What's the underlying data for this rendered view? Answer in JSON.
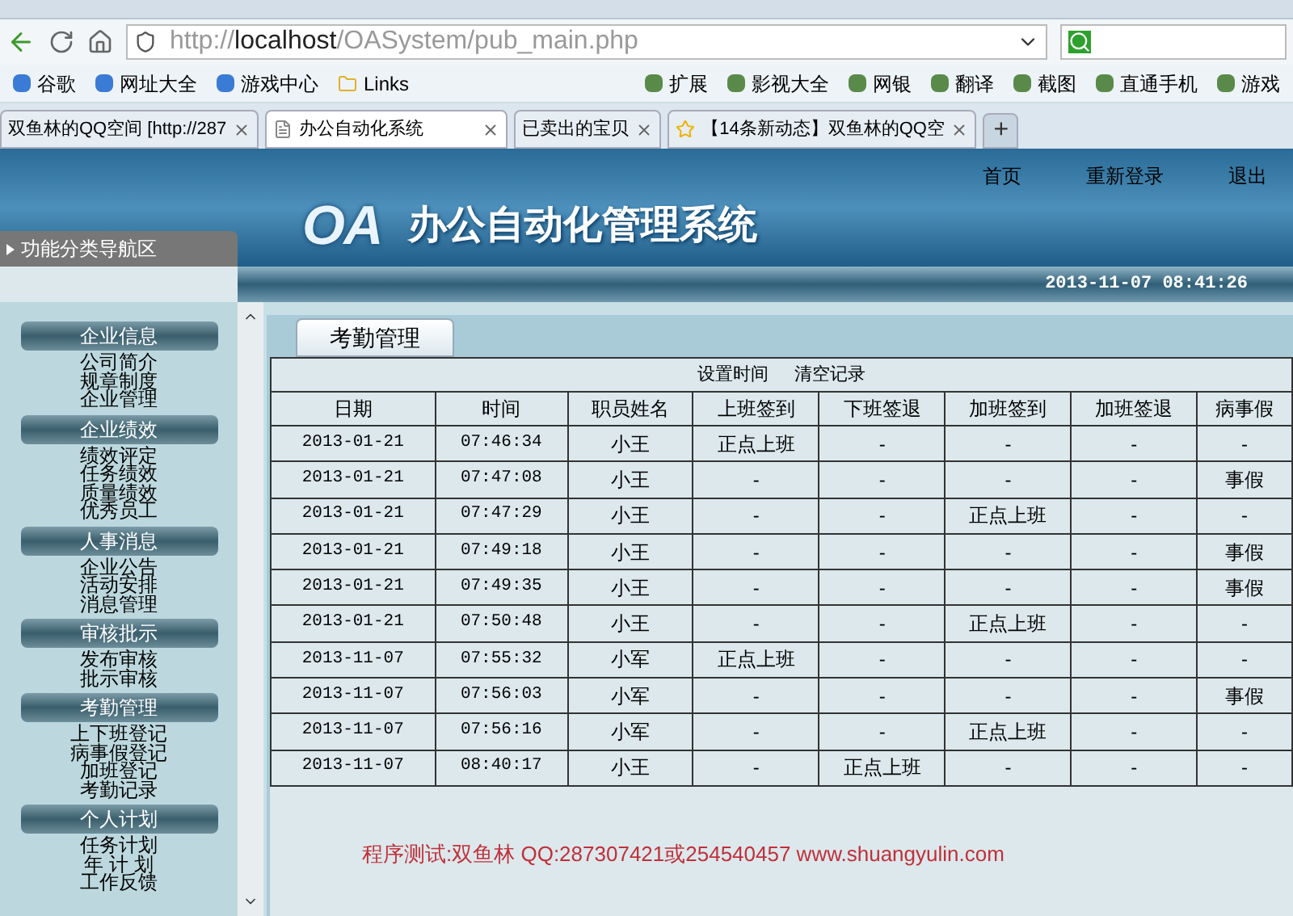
{
  "browser": {
    "url": {
      "scheme": "http://",
      "host": "localhost",
      "path": "/OASystem/pub_main.php"
    },
    "bookmarks": [
      "谷歌",
      "网址大全",
      "游戏中心",
      "Links"
    ],
    "bookmarks_right": [
      "扩展",
      "影视大全",
      "网银",
      "翻译",
      "截图",
      "直通手机",
      "游戏"
    ],
    "tabs": [
      {
        "label": "双鱼林的QQ空间 [http://287",
        "selected": false
      },
      {
        "label": "办公自动化系统",
        "selected": true
      },
      {
        "label": "已卖出的宝贝",
        "selected": false
      },
      {
        "label": "【14条新动态】双鱼林的QQ空",
        "selected": false
      }
    ],
    "new_tab": "+"
  },
  "header": {
    "nav_links": [
      "首页",
      "重新登录",
      "退出"
    ],
    "logo": "OA",
    "title": "办公自动化管理系统",
    "datetime": "2013-11-07 08:41:26"
  },
  "sidebar": {
    "heading": "功能分类导航区",
    "sections": [
      {
        "title": "企业信息",
        "items": [
          "公司简介",
          "规章制度",
          "企业管理"
        ]
      },
      {
        "title": "企业绩效",
        "items": [
          "绩效评定",
          "任务绩效",
          "质量绩效",
          "优秀员工"
        ]
      },
      {
        "title": "人事消息",
        "items": [
          "企业公告",
          "活动安排",
          "消息管理"
        ]
      },
      {
        "title": "审核批示",
        "items": [
          "发布审核",
          "批示审核"
        ]
      },
      {
        "title": "考勤管理",
        "items": [
          "上下班登记",
          "病事假登记",
          "加班登记",
          "考勤记录"
        ]
      },
      {
        "title": "个人计划",
        "items": [
          "任务计划",
          "年 计 划",
          "工作反馈"
        ]
      }
    ]
  },
  "content": {
    "tab_label": "考勤管理",
    "actions": [
      "设置时间",
      "清空记录"
    ],
    "table": {
      "columns": [
        "日期",
        "时间",
        "职员姓名",
        "上班签到",
        "下班签退",
        "加班签到",
        "加班签退",
        "病事假"
      ],
      "rows": [
        [
          "2013-01-21",
          "07:46:34",
          "小王",
          "正点上班",
          "-",
          "-",
          "-",
          "-"
        ],
        [
          "2013-01-21",
          "07:47:08",
          "小王",
          "-",
          "-",
          "-",
          "-",
          "事假"
        ],
        [
          "2013-01-21",
          "07:47:29",
          "小王",
          "-",
          "-",
          "正点上班",
          "-",
          "-"
        ],
        [
          "2013-01-21",
          "07:49:18",
          "小王",
          "-",
          "-",
          "-",
          "-",
          "事假"
        ],
        [
          "2013-01-21",
          "07:49:35",
          "小王",
          "-",
          "-",
          "-",
          "-",
          "事假"
        ],
        [
          "2013-01-21",
          "07:50:48",
          "小王",
          "-",
          "-",
          "正点上班",
          "-",
          "-"
        ],
        [
          "2013-11-07",
          "07:55:32",
          "小军",
          "正点上班",
          "-",
          "-",
          "-",
          "-"
        ],
        [
          "2013-11-07",
          "07:56:03",
          "小军",
          "-",
          "-",
          "-",
          "-",
          "事假"
        ],
        [
          "2013-11-07",
          "07:56:16",
          "小军",
          "-",
          "-",
          "正点上班",
          "-",
          "-"
        ],
        [
          "2013-11-07",
          "08:40:17",
          "小王",
          "-",
          "正点上班",
          "-",
          "-",
          "-"
        ]
      ]
    }
  },
  "footer_text": "程序测试:双鱼林 QQ:287307421或254540457 www.shuangyulin.com"
}
